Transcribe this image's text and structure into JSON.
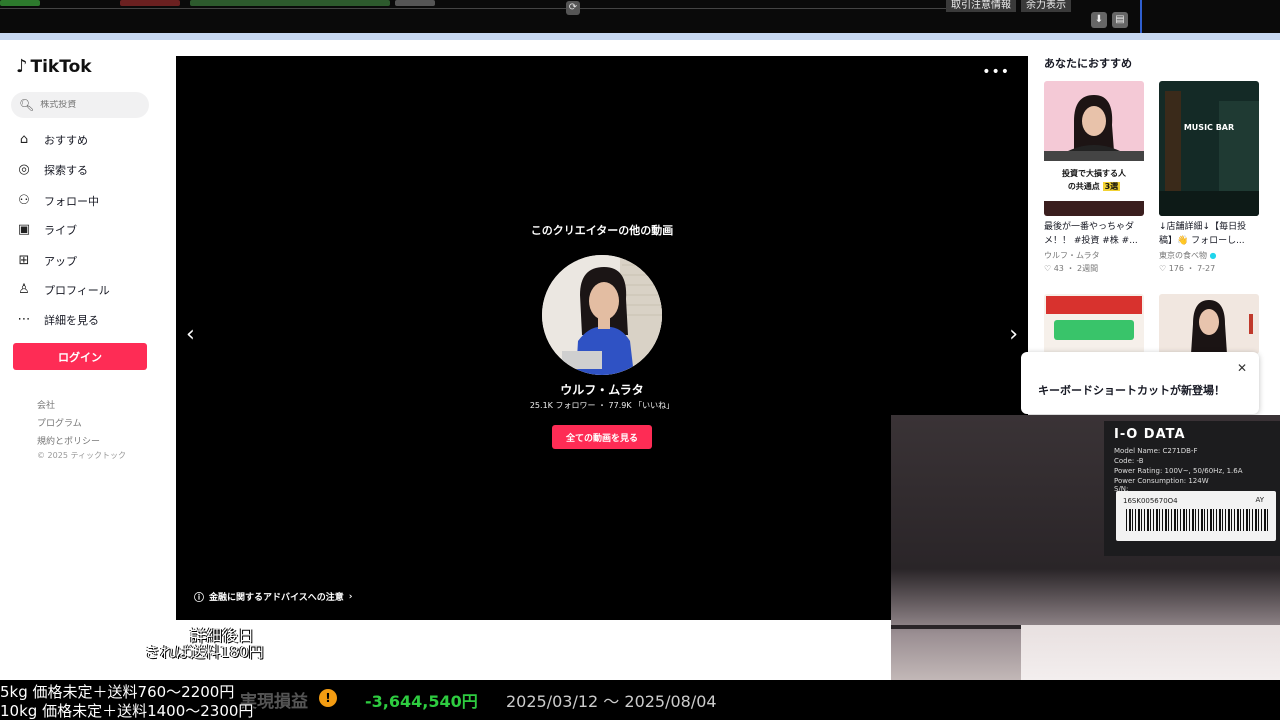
{
  "top_bar": {
    "button_1": "取引注意情報",
    "button_2": "余力表示"
  },
  "colors": {
    "brand_red": "#fe2c55",
    "profit_green": "#2ecc40",
    "highlight_blue": "#2f5fd0"
  },
  "sidebar": {
    "logo": "TikTok",
    "search_placeholder": "株式投資",
    "nav": [
      {
        "label": "おすすめ",
        "icon": "home-icon"
      },
      {
        "label": "探索する",
        "icon": "compass-icon"
      },
      {
        "label": "フォロー中",
        "icon": "follow-icon"
      },
      {
        "label": "ライブ",
        "icon": "live-icon"
      },
      {
        "label": "アップ",
        "icon": "upload-icon"
      },
      {
        "label": "プロフィール",
        "icon": "profile-icon"
      },
      {
        "label": "詳細を見る",
        "icon": "more-icon"
      }
    ],
    "login_label": "ログイン",
    "footer": [
      "会社",
      "プログラム",
      "規約とポリシー"
    ],
    "copyright": "© 2025 ティックトック"
  },
  "player": {
    "heading": "このクリエイターの他の動画",
    "creator_name": "ウルフ・ムラタ",
    "stats": "25.1K フォロワー ・ 77.9K 「いいね」",
    "all_videos_label": "全ての動画を見る",
    "advice_text": "金融に関するアドバイスへの注意"
  },
  "recommendations": {
    "title": "あなたにおすすめ",
    "cards": [
      {
        "thumb_caption_1": "投資で大損する人",
        "thumb_caption_2": "の共通点",
        "thumb_caption_badge": "3選",
        "description": "最後が一番やっちゃダメ！！ #投資 #株 #...",
        "author": "ウルフ・ムラタ",
        "meta": "♡ 43 ・ 2週間"
      },
      {
        "thumb_caption_1": "MUSIC BAR",
        "description": "↓店舗詳細↓【毎日投稿】👋 フォローし...",
        "author": "東京の食べ物",
        "meta": "♡ 176 ・ 7-27"
      }
    ],
    "toast_message": "キーボードショートカットが新登場！"
  },
  "webcam": {
    "brand": "I-O DATA",
    "model": "Model Name:  C271DB-F",
    "code": "Code:  -B",
    "power_rating": "Power Rating: 100V~, 50/60Hz, 1.6A",
    "power_consumption": "Power Consumption:  124W",
    "sn_label": "S/N:",
    "serial": "16SK005670O4",
    "suffix": "AY"
  },
  "overlays": {
    "detail_line": "詳細後日",
    "shipping_line": "きれば送料180円",
    "line_5kg": "5kg  価格未定＋送料760～2200円",
    "line_10kg": "10kg  価格未定＋送料1400～2300円",
    "profit_label": "実現損益",
    "profit_value": "-3,644,540円",
    "date_range": "2025/03/12 ～ 2025/08/04"
  }
}
